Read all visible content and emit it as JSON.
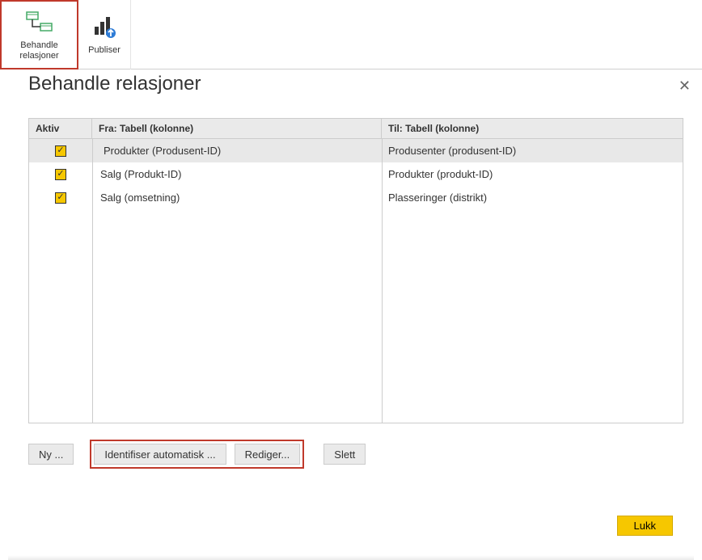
{
  "ribbon": {
    "manage_relations": {
      "label_line1": "Behandle",
      "label_line2": "relasjoner"
    },
    "publish": {
      "label": "Publiser"
    }
  },
  "dialog": {
    "title": "Behandle relasjoner",
    "close": "✕",
    "columns": {
      "active": "Aktiv",
      "from": "Fra: Tabell (kolonne)",
      "to": "Til: Tabell (kolonne)"
    },
    "rows": [
      {
        "active": true,
        "from": "Produkter (Produsent-ID)",
        "to": "Produsenter (produsent-ID)",
        "selected": true
      },
      {
        "active": true,
        "from": "Salg (Produkt-ID)",
        "to": "Produkter (produkt-ID)",
        "selected": false
      },
      {
        "active": true,
        "from": "Salg (omsetning)",
        "to": "Plasseringer (distrikt)",
        "selected": false
      }
    ],
    "buttons": {
      "new": "Ny ...",
      "auto_detect": "Identifiser automatisk ...",
      "edit": "Rediger...",
      "delete": "Slett",
      "close_btn": "Lukk"
    }
  }
}
